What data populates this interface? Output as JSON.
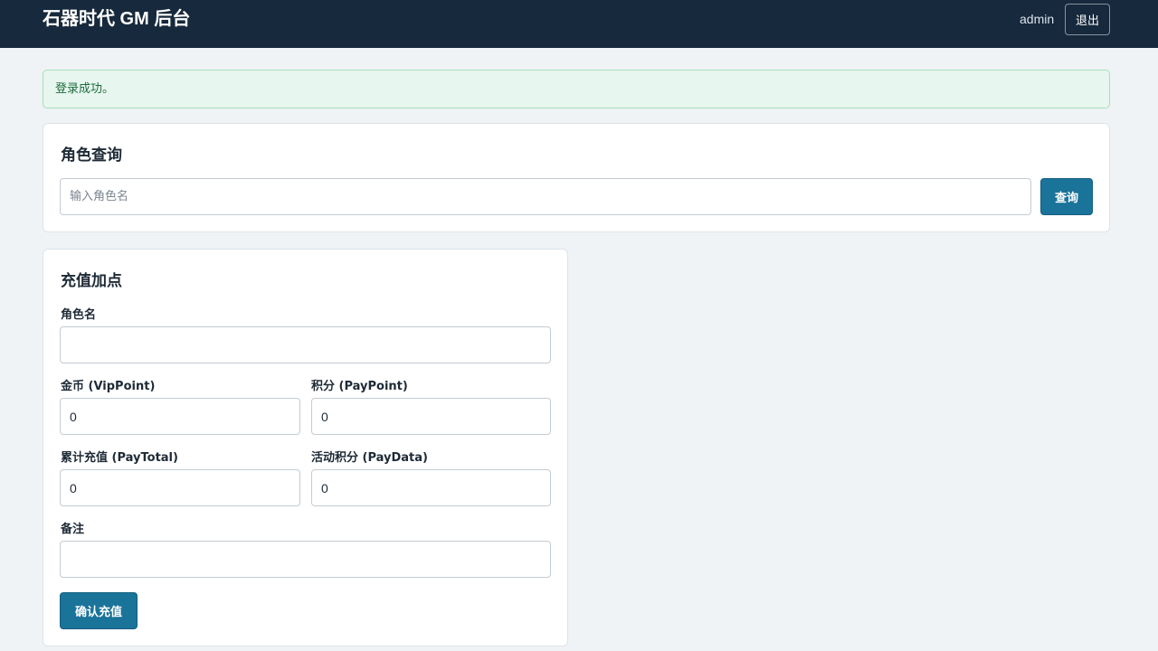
{
  "header": {
    "title": "石器时代 GM 后台",
    "username": "admin",
    "logout_label": "退出"
  },
  "alert": {
    "message": "登录成功。"
  },
  "role_query": {
    "title": "角色查询",
    "input_placeholder": "输入角色名",
    "input_value": "",
    "button_label": "查询"
  },
  "recharge": {
    "title": "充值加点",
    "role_name": {
      "label": "角色名",
      "value": ""
    },
    "vip_point": {
      "label": "金币 (VipPoint)",
      "value": "0"
    },
    "pay_point": {
      "label": "积分 (PayPoint)",
      "value": "0"
    },
    "pay_total": {
      "label": "累计充值 (PayTotal)",
      "value": "0"
    },
    "pay_data": {
      "label": "活动积分 (PayData)",
      "value": "0"
    },
    "remark": {
      "label": "备注",
      "value": ""
    },
    "submit_label": "确认充值"
  }
}
